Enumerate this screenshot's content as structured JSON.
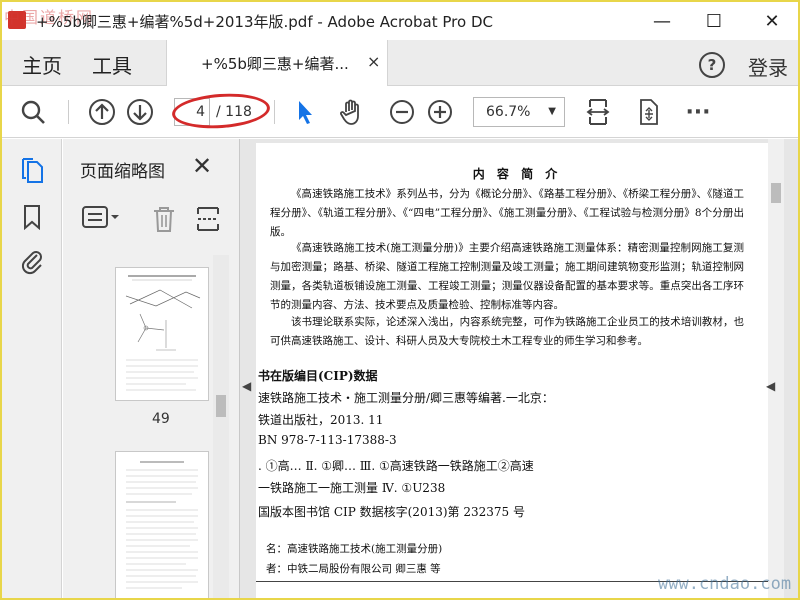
{
  "window": {
    "title": "+%5b卿三惠+编著%5d+2013年版.pdf - Adobe Acrobat Pro DC",
    "watermark_tl": "中国道桥网",
    "minimize": "—",
    "maximize": "☐",
    "close": "✕"
  },
  "menu": {
    "home": "主页",
    "tools": "工具",
    "doc_tab_label": "+%5b卿三惠+编著...",
    "doc_tab_close": "×",
    "help": "?",
    "login": "登录"
  },
  "toolbar": {
    "current_page": "4",
    "total_pages": "/ 118",
    "zoom": "66.7%",
    "zoom_arrow": "▼",
    "more": "···",
    "highlight_color": "#d42a2a",
    "accent_color": "#1473e6"
  },
  "thumbnails": {
    "title": "页面缩略图",
    "close": "✕",
    "pages": [
      {
        "number": "49"
      }
    ]
  },
  "document": {
    "heading": "内 容 简 介",
    "paragraphs": [
      "《高速铁路施工技术》系列丛书，分为《概论分册》、《路基工程分册》、《桥梁工程分册》、《隧道工程分册》、《轨道工程分册》、《“四电”工程分册》、《施工测量分册》、《工程试验与检测分册》8个分册出版。",
      "《高速铁路施工技术(施工测量分册)》主要介绍高速铁路施工测量体系：精密测量控制网施工复测与加密测量；路基、桥梁、隧道工程施工控制测量及竣工测量；施工期间建筑物变形监测；轨道控制网测量，各类轨道板铺设施工测量、工程竣工测量；测量仪器设备配置的基本要求等。重点突出各工序环节的测量内容、方法、技术要点及质量检验、控制标准等内容。",
      "该书理论联系实际，论述深入浅出，内容系统完整，可作为铁路施工企业员工的技术培训教材，也可供高速铁路施工、设计、科研人员及大专院校土木工程专业的师生学习和参考。"
    ],
    "cip_lines": [
      "书在版编目(CIP)数据",
      "速铁路施工技术・施工测量分册/卿三惠等编著.一北京：",
      "铁道出版社，2013. 11",
      "BN 978-7-113-17388-3",
      ". ①高…  Ⅱ. ①卿…  Ⅲ. ①高速铁路一铁路施工②高速",
      "一铁路施工一施工测量  Ⅳ. ①U238",
      "国版本图书馆 CIP 数据核字(2013)第 232375 号"
    ],
    "footer_lines": [
      "名：高速铁路施工技术(施工测量分册)",
      "者：中铁二局股份有限公司  卿三惠  等"
    ]
  },
  "watermark_br": "www.cndao.com"
}
